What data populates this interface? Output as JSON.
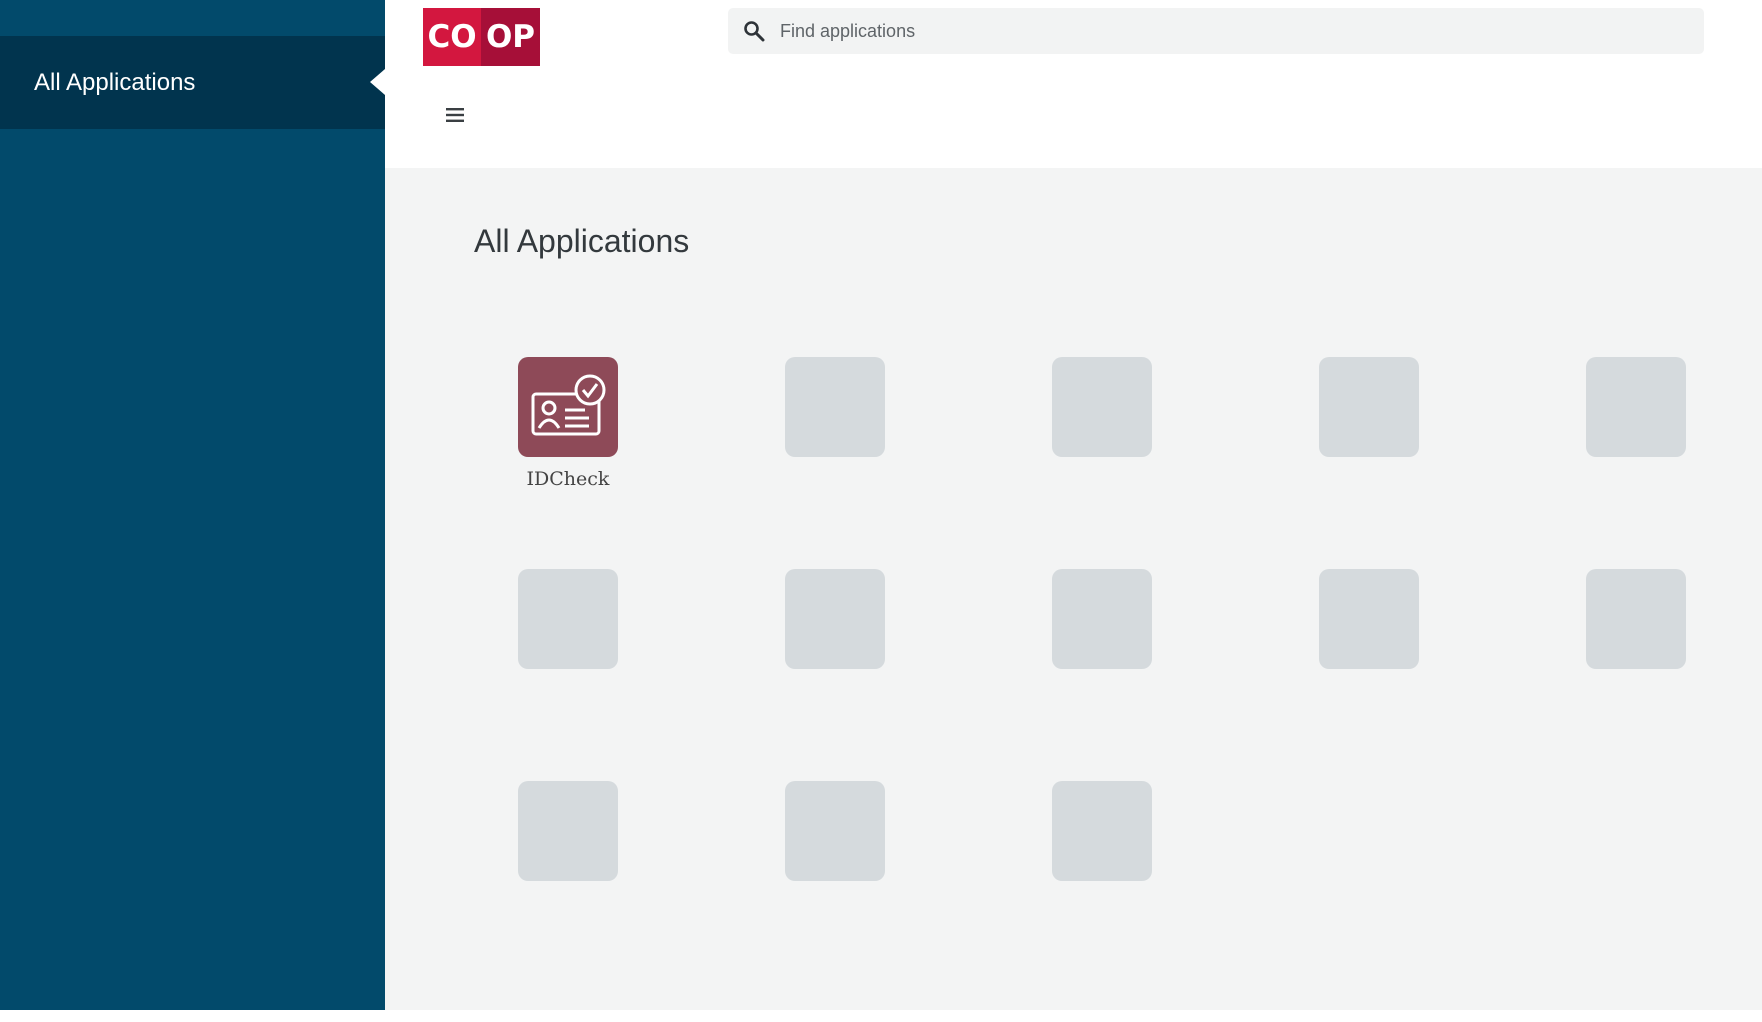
{
  "sidebar": {
    "items": [
      {
        "label": "All Applications",
        "active": true
      }
    ],
    "color": "#024a6b",
    "active_color": "#01344e"
  },
  "header": {
    "logo": {
      "left": "CO",
      "right": "OP",
      "colors": [
        "#d3173f",
        "#a60f38"
      ]
    },
    "menu_icon": "hamburger-menu-icon",
    "search": {
      "placeholder": "Find applications",
      "icon": "search-icon"
    }
  },
  "main": {
    "title": "All Applications",
    "apps": [
      {
        "label": "IDCheck",
        "icon": "id-card-check-icon",
        "color": "#8e4a58",
        "loaded": true
      },
      {
        "loaded": false
      },
      {
        "loaded": false
      },
      {
        "loaded": false
      },
      {
        "loaded": false
      },
      {
        "loaded": false
      },
      {
        "loaded": false
      },
      {
        "loaded": false
      },
      {
        "loaded": false
      },
      {
        "loaded": false
      },
      {
        "loaded": false
      },
      {
        "loaded": false
      },
      {
        "loaded": false
      }
    ]
  }
}
